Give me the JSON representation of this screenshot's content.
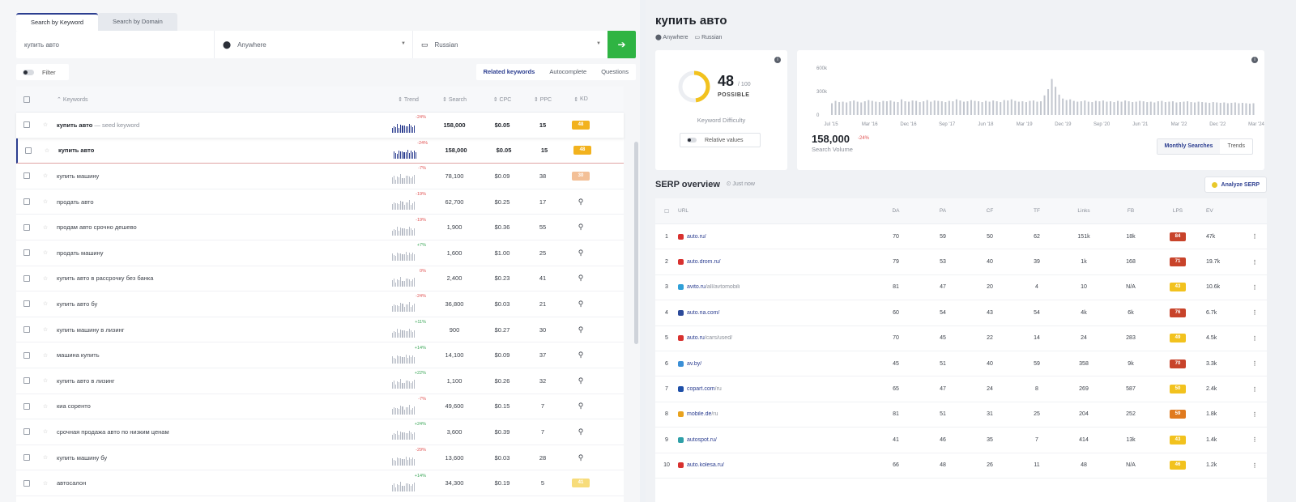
{
  "left": {
    "tabs": [
      "Search by Keyword",
      "Search by Domain"
    ],
    "search": {
      "keyword": "купить авто",
      "location": "Anywhere",
      "language": "Russian"
    },
    "filter_label": "Filter",
    "segments": [
      "Related keywords",
      "Autocomplete",
      "Questions"
    ],
    "columns": {
      "keyword": "Keywords",
      "trend": "Trend",
      "search": "Search",
      "cpc": "CPC",
      "ppc": "PPC",
      "kd": "KD"
    },
    "rows": [
      {
        "keyword": "купить авто",
        "suffix": " — seed keyword",
        "trend": "-24%",
        "search": "158,000",
        "cpc": "$0.05",
        "ppc": "15",
        "kd": "48",
        "kd_color": "#f2b21e",
        "bold": true
      },
      {
        "keyword": "купить авто",
        "suffix": "",
        "trend": "-24%",
        "search": "158,000",
        "cpc": "$0.05",
        "ppc": "15",
        "kd": "48",
        "kd_color": "#f2b21e",
        "bold": true
      },
      {
        "keyword": "купить машину",
        "suffix": "",
        "trend": "-7%",
        "search": "78,100",
        "cpc": "$0.09",
        "ppc": "38",
        "kd": "30",
        "kd_color": "#f3c097",
        "bold": false
      },
      {
        "keyword": "продать авто",
        "suffix": "",
        "trend": "-19%",
        "search": "62,700",
        "cpc": "$0.25",
        "ppc": "17",
        "kd": "",
        "kd_color": "",
        "bold": false
      },
      {
        "keyword": "продам авто срочно дешево",
        "suffix": "",
        "trend": "-19%",
        "search": "1,900",
        "cpc": "$0.36",
        "ppc": "55",
        "kd": "",
        "kd_color": "",
        "bold": false
      },
      {
        "keyword": "продать машину",
        "suffix": "",
        "trend": "+7%",
        "search": "1,600",
        "cpc": "$1.00",
        "ppc": "25",
        "kd": "",
        "kd_color": "",
        "bold": false
      },
      {
        "keyword": "купить авто в рассрочку без банка",
        "suffix": "",
        "trend": "0%",
        "search": "2,400",
        "cpc": "$0.23",
        "ppc": "41",
        "kd": "",
        "kd_color": "",
        "bold": false
      },
      {
        "keyword": "купить авто бу",
        "suffix": "",
        "trend": "-24%",
        "search": "36,800",
        "cpc": "$0.03",
        "ppc": "21",
        "kd": "",
        "kd_color": "",
        "bold": false
      },
      {
        "keyword": "купить машину в лизинг",
        "suffix": "",
        "trend": "+11%",
        "search": "900",
        "cpc": "$0.27",
        "ppc": "30",
        "kd": "",
        "kd_color": "",
        "bold": false
      },
      {
        "keyword": "машина купить",
        "suffix": "",
        "trend": "+14%",
        "search": "14,100",
        "cpc": "$0.09",
        "ppc": "37",
        "kd": "",
        "kd_color": "",
        "bold": false
      },
      {
        "keyword": "купить авто в лизинг",
        "suffix": "",
        "trend": "+22%",
        "search": "1,100",
        "cpc": "$0.26",
        "ppc": "32",
        "kd": "",
        "kd_color": "",
        "bold": false
      },
      {
        "keyword": "киа соренто",
        "suffix": "",
        "trend": "-7%",
        "search": "49,600",
        "cpc": "$0.15",
        "ppc": "7",
        "kd": "",
        "kd_color": "",
        "bold": false
      },
      {
        "keyword": "срочная продажа авто по низким ценам",
        "suffix": "",
        "trend": "+24%",
        "search": "3,600",
        "cpc": "$0.39",
        "ppc": "7",
        "kd": "",
        "kd_color": "",
        "bold": false
      },
      {
        "keyword": "купить машину бу",
        "suffix": "",
        "trend": "-29%",
        "search": "13,600",
        "cpc": "$0.03",
        "ppc": "28",
        "kd": "",
        "kd_color": "",
        "bold": false
      },
      {
        "keyword": "автосалон",
        "suffix": "",
        "trend": "+14%",
        "search": "34,300",
        "cpc": "$0.19",
        "ppc": "5",
        "kd": "41",
        "kd_color": "#f7dc7a",
        "bold": false
      }
    ]
  },
  "right": {
    "title": "купить авто",
    "location": "Anywhere",
    "language": "Russian",
    "kd": {
      "value": "48",
      "max": "/ 100",
      "label": "POSSIBLE",
      "title": "Keyword Difficulty",
      "relative_label": "Relative values",
      "color": "#f2c21e"
    },
    "volume": {
      "value": "158,000",
      "change": "-24%",
      "label": "Search Volume",
      "segments": [
        "Monthly Searches",
        "Trends"
      ]
    },
    "chart_data": {
      "type": "bar",
      "title": "",
      "yticks": [
        "600k",
        "300k",
        "0"
      ],
      "ylim": [
        0,
        600000
      ],
      "xticks": [
        "Jul '15",
        "Mar '16",
        "Dec '16",
        "Sep '17",
        "Jun '18",
        "Mar '19",
        "Dec '19",
        "Sep '20",
        "Jun '21",
        "Mar '22",
        "Dec '22",
        "Mar '24"
      ],
      "values": [
        150000,
        180000,
        165000,
        170000,
        160000,
        175000,
        185000,
        170000,
        160000,
        175000,
        190000,
        180000,
        170000,
        165000,
        180000,
        175000,
        185000,
        170000,
        165000,
        200000,
        175000,
        170000,
        185000,
        180000,
        165000,
        175000,
        190000,
        170000,
        185000,
        180000,
        175000,
        165000,
        180000,
        175000,
        200000,
        185000,
        170000,
        175000,
        190000,
        180000,
        175000,
        165000,
        180000,
        170000,
        185000,
        175000,
        165000,
        190000,
        185000,
        200000,
        180000,
        170000,
        175000,
        165000,
        180000,
        185000,
        170000,
        175000,
        250000,
        330000,
        460000,
        360000,
        260000,
        210000,
        190000,
        200000,
        180000,
        170000,
        175000,
        185000,
        170000,
        165000,
        180000,
        175000,
        185000,
        170000,
        175000,
        165000,
        180000,
        170000,
        185000,
        175000,
        165000,
        170000,
        180000,
        175000,
        165000,
        170000,
        160000,
        175000,
        180000,
        165000,
        170000,
        175000,
        160000,
        165000,
        170000,
        175000,
        165000,
        160000,
        170000,
        165000,
        160000,
        155000,
        165000,
        160000,
        155000,
        160000,
        150000,
        155000,
        160000,
        150000,
        155000,
        150000,
        145000,
        150000
      ]
    },
    "serp": {
      "title": "SERP overview",
      "time": "Just now",
      "analyze_label": "Analyze SERP",
      "columns": [
        "URL",
        "DA",
        "PA",
        "CF",
        "TF",
        "Links",
        "FB",
        "LPS",
        "EV"
      ],
      "rows": [
        {
          "n": "1",
          "domain": "auto.ru/",
          "path": "",
          "fav": "#d8312f",
          "da": "70",
          "pa": "59",
          "cf": "50",
          "tf": "62",
          "links": "151k",
          "fb": "18k",
          "lps": "84",
          "lps_color": "#c8432a",
          "ev": "47k"
        },
        {
          "n": "2",
          "domain": "auto.drom.ru/",
          "path": "",
          "fav": "#d8312f",
          "da": "79",
          "pa": "53",
          "cf": "40",
          "tf": "39",
          "links": "1k",
          "fb": "168",
          "lps": "71",
          "lps_color": "#c8432a",
          "ev": "19.7k"
        },
        {
          "n": "3",
          "domain": "avito.ru",
          "path": "/all/avtomobili",
          "fav": "#2fa0d8",
          "da": "81",
          "pa": "47",
          "cf": "20",
          "tf": "4",
          "links": "10",
          "fb": "N/A",
          "lps": "43",
          "lps_color": "#f2c21e",
          "ev": "10.6k"
        },
        {
          "n": "4",
          "domain": "auto.ria.com/",
          "path": "",
          "fav": "#2c4a9a",
          "da": "60",
          "pa": "54",
          "cf": "43",
          "tf": "54",
          "links": "4k",
          "fb": "6k",
          "lps": "76",
          "lps_color": "#c8432a",
          "ev": "6.7k"
        },
        {
          "n": "5",
          "domain": "auto.ru",
          "path": "/cars/used/",
          "fav": "#d8312f",
          "da": "70",
          "pa": "45",
          "cf": "22",
          "tf": "14",
          "links": "24",
          "fb": "283",
          "lps": "49",
          "lps_color": "#f2c21e",
          "ev": "4.5k"
        },
        {
          "n": "6",
          "domain": "av.by/",
          "path": "",
          "fav": "#3b8fd6",
          "da": "45",
          "pa": "51",
          "cf": "40",
          "tf": "59",
          "links": "358",
          "fb": "9k",
          "lps": "70",
          "lps_color": "#c8432a",
          "ev": "3.3k"
        },
        {
          "n": "7",
          "domain": "copart.com",
          "path": "/ru",
          "fav": "#1e4fa8",
          "da": "65",
          "pa": "47",
          "cf": "24",
          "tf": "8",
          "links": "269",
          "fb": "587",
          "lps": "50",
          "lps_color": "#f2c21e",
          "ev": "2.4k"
        },
        {
          "n": "8",
          "domain": "mobile.de",
          "path": "/ru",
          "fav": "#e8a21e",
          "da": "81",
          "pa": "51",
          "cf": "31",
          "tf": "25",
          "links": "204",
          "fb": "252",
          "lps": "59",
          "lps_color": "#e07a1e",
          "ev": "1.8k"
        },
        {
          "n": "9",
          "domain": "autospot.ru/",
          "path": "",
          "fav": "#2fa0a8",
          "da": "41",
          "pa": "46",
          "cf": "35",
          "tf": "7",
          "links": "414",
          "fb": "13k",
          "lps": "43",
          "lps_color": "#f2c21e",
          "ev": "1.4k"
        },
        {
          "n": "10",
          "domain": "auto.kolesa.ru/",
          "path": "",
          "fav": "#d8312f",
          "da": "66",
          "pa": "48",
          "cf": "26",
          "tf": "11",
          "links": "48",
          "fb": "N/A",
          "lps": "46",
          "lps_color": "#f2c21e",
          "ev": "1.2k"
        }
      ]
    }
  }
}
